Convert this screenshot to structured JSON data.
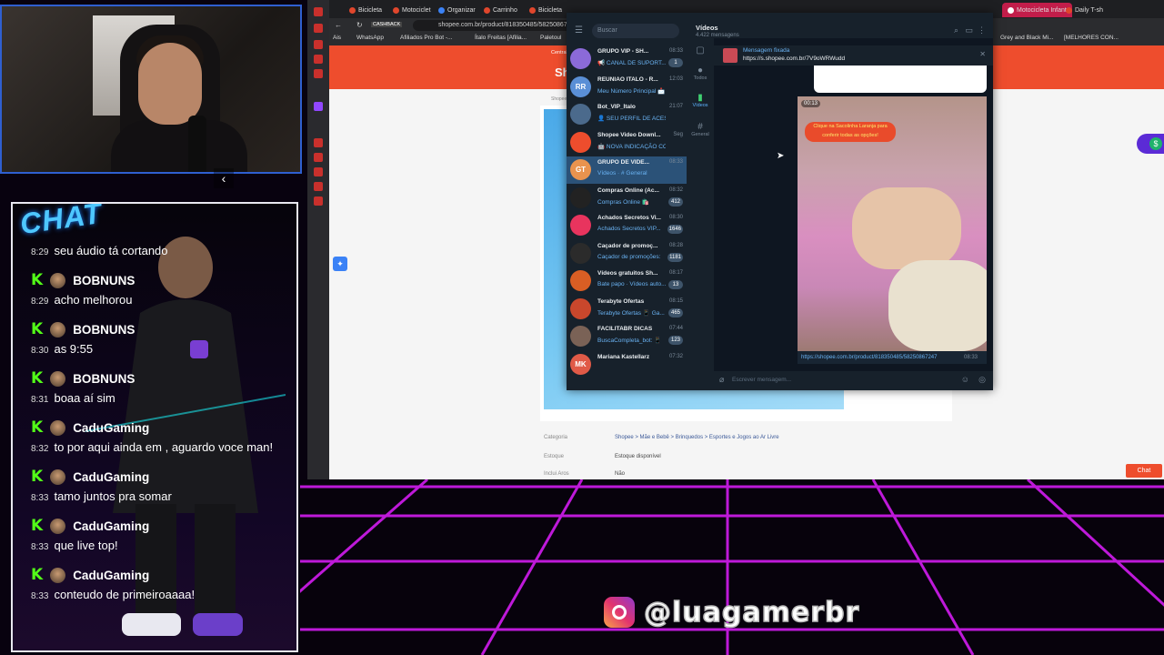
{
  "chat": {
    "logo": "CHAT",
    "messages": [
      {
        "time": "8:29",
        "text": "seu áudio tá cortando"
      },
      {
        "user": "BOBNUNS",
        "time": "8:29",
        "text": "acho melhorou"
      },
      {
        "user": "BOBNUNS",
        "time": "8:30",
        "text": "as 9:55"
      },
      {
        "user": "BOBNUNS",
        "time": "8:31",
        "text": "boaa aí sim"
      },
      {
        "user": "CaduGaming",
        "time": "8:32",
        "text": "to por aqui ainda em , aguardo voce man!"
      },
      {
        "user": "CaduGaming",
        "time": "8:33",
        "text": "tamo juntos pra somar"
      },
      {
        "user": "CaduGaming",
        "time": "8:33",
        "text": "que live top!"
      },
      {
        "user": "CaduGaming",
        "time": "8:33",
        "text": "conteudo de primeiroaaaa!"
      }
    ]
  },
  "browser": {
    "tabs": [
      "Bicicleta",
      "Motociclet",
      "Organizar",
      "Carrinho",
      "Bicicleta",
      "Motocicleta Infant",
      "Daily T-sh"
    ],
    "url": "shopee.com.br/product/818350485/58250867247",
    "cashback": "CASHBACK",
    "bookmarks": [
      "Ais",
      "WhatsApp",
      "Afiliados Pro Bot -...",
      "Ítalo Freitas [Afilia...",
      "Paletoul",
      "Grey and Black Mi...",
      "[MELHORES CON..."
    ],
    "shopee": {
      "logo": "Shopee",
      "seller_center": "Central do Vendedor",
      "breadcrumb": "Shopee > Mãe e Bebê",
      "specs": [
        {
          "label": "Categoria",
          "value": "Shopee > Mãe e Bebê > Brinquedos > Esportes e Jogos ao Ar Livre"
        },
        {
          "label": "Estoque",
          "value": "Estoque disponível"
        },
        {
          "label": "Inclui Aros",
          "value": "Não"
        }
      ],
      "chat_button": "Chat"
    }
  },
  "telegram": {
    "search_placeholder": "Buscar",
    "chats": [
      {
        "initials": "",
        "name": "GRUPO VIP - SH...",
        "time": "08:33",
        "preview": "📢 CANAL DE SUPORT... ❤️",
        "sub": "Você: oi 2",
        "badge": "1",
        "color": "#8b6ad8"
      },
      {
        "initials": "RR",
        "name": "REUNIAO ITALO - R...",
        "time": "12:03",
        "preview": "Meu Número Principal 📩",
        "badge": "",
        "color": "#5a8fd6"
      },
      {
        "initials": "",
        "name": "Bot_VIP_Ítalo",
        "time": "21:07",
        "preview": "👤 SEU PERFIL DE ACESS...",
        "badge": "",
        "color": "#4b6a8c"
      },
      {
        "initials": "",
        "name": "Shopee Video Downl...",
        "time": "Seg",
        "preview": "🤖 NOVA INDICAÇÃO CO...",
        "badge": "",
        "color": "#ee4d2d"
      },
      {
        "initials": "GT",
        "name": "GRUPO DE VIDE...",
        "time": "08:33",
        "preview": "Vídeos · # General",
        "sub": "Você: 🛒 https://shopee.com...",
        "badge": "",
        "color": "#e9934e"
      },
      {
        "initials": "",
        "name": "Compras Online (Ac...",
        "time": "08:32",
        "preview": "Compras Online 🛍️",
        "badge": "412",
        "color": "#222"
      },
      {
        "initials": "",
        "name": "Achados Secretos Vi...",
        "time": "08:30",
        "preview": "Achados Secretos VIP...",
        "badge": "1646",
        "color": "#e8345e"
      },
      {
        "initials": "",
        "name": "Caçador de promoç...",
        "time": "08:28",
        "preview": "Caçador de promoções:",
        "badge": "1181",
        "color": "#2b2b2b"
      },
      {
        "initials": "",
        "name": "Vídeos gratuitos Sh...",
        "time": "08:17",
        "preview": "Bate papo · Vídeos auto...",
        "sub": "Stefane: As conversões j...",
        "badge": "13",
        "color": "#d95e24"
      },
      {
        "initials": "",
        "name": "Terabyte Ofertas",
        "time": "08:15",
        "preview": "Terabyte Ofertas 📱 Ga...",
        "badge": "465",
        "color": "#c9472c"
      },
      {
        "initials": "",
        "name": "FACILITABR DICAS",
        "time": "07:44",
        "preview": "BuscaCompleta_bot: 📱",
        "badge": "123",
        "color": "#7a6256"
      },
      {
        "initials": "MK",
        "name": "Mariana Kastellarz",
        "time": "07:32",
        "preview": "",
        "badge": "",
        "color": "#e05a47"
      }
    ],
    "folders": [
      "Todos",
      "Vídeos",
      "General"
    ],
    "header": {
      "title": "Vídeos",
      "members": "4.422 mensagens"
    },
    "pinned": {
      "label": "Mensagem fixada",
      "url": "https://s.shopee.com.br/7V9oWRWudd"
    },
    "video": {
      "duration": "00:13",
      "sticker": "Clique na Sacolinha Laranja para conferir todas as opções!",
      "link": "https://shopee.com.br/product/818350485/58250867247",
      "time": "08:33"
    },
    "input_placeholder": "Escrever mensagem..."
  },
  "instagram": {
    "handle": "@luagamerbr"
  }
}
